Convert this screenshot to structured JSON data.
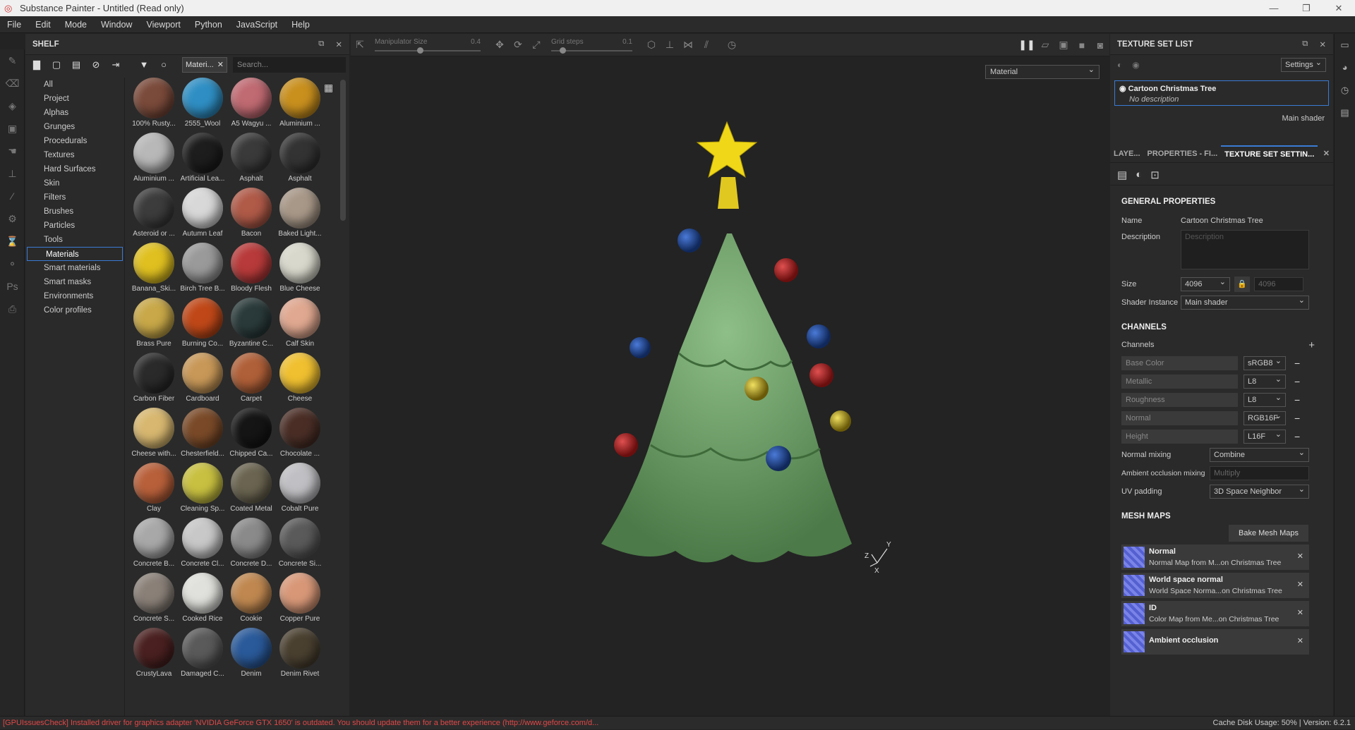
{
  "title": "Substance Painter - Untitled (Read only)",
  "menu": [
    "File",
    "Edit",
    "Mode",
    "Window",
    "Viewport",
    "Python",
    "JavaScript",
    "Help"
  ],
  "shelf": {
    "title": "SHELF",
    "filter_chip": "Materi...",
    "search_placeholder": "Search...",
    "categories": [
      "All",
      "Project",
      "Alphas",
      "Grunges",
      "Procedurals",
      "Textures",
      "Hard Surfaces",
      "Skin",
      "Filters",
      "Brushes",
      "Particles",
      "Tools",
      "Materials",
      "Smart materials",
      "Smart masks",
      "Environments",
      "Color profiles"
    ],
    "selected_category": "Materials",
    "materials": [
      {
        "name": "100% Rusty...",
        "color": "#7a4a3a"
      },
      {
        "name": "2555_Wool",
        "color": "#2f8fc4"
      },
      {
        "name": "A5 Wagyu ...",
        "color": "#c06a72"
      },
      {
        "name": "Aluminium ...",
        "color": "#c9901e"
      },
      {
        "name": "Aluminium ...",
        "color": "#b8b8b8"
      },
      {
        "name": "Artificial Lea...",
        "color": "#1d1d1d"
      },
      {
        "name": "Asphalt",
        "color": "#3a3a3a"
      },
      {
        "name": "Asphalt",
        "color": "#333333"
      },
      {
        "name": "Asteroid or ...",
        "color": "#3c3c3c"
      },
      {
        "name": "Autumn Leaf",
        "color": "#d8d8d8"
      },
      {
        "name": "Bacon",
        "color": "#b05a48"
      },
      {
        "name": "Baked Light...",
        "color": "#a89888"
      },
      {
        "name": "Banana_Ski...",
        "color": "#e0c020"
      },
      {
        "name": "Birch Tree B...",
        "color": "#9a9a9a"
      },
      {
        "name": "Bloody Flesh",
        "color": "#b83a3a"
      },
      {
        "name": "Blue Cheese",
        "color": "#d8d8cc"
      },
      {
        "name": "Brass Pure",
        "color": "#c8a848"
      },
      {
        "name": "Burning Co...",
        "color": "#c04818"
      },
      {
        "name": "Byzantine C...",
        "color": "#2a3a3a"
      },
      {
        "name": "Calf Skin",
        "color": "#e0a890"
      },
      {
        "name": "Carbon Fiber",
        "color": "#2a2a2a"
      },
      {
        "name": "Cardboard",
        "color": "#c89858"
      },
      {
        "name": "Carpet",
        "color": "#b06038"
      },
      {
        "name": "Cheese",
        "color": "#f0c030"
      },
      {
        "name": "Cheese with...",
        "color": "#d8b870"
      },
      {
        "name": "Chesterfield...",
        "color": "#7a4a28"
      },
      {
        "name": "Chipped Ca...",
        "color": "#151515"
      },
      {
        "name": "Chocolate ...",
        "color": "#4a2e26"
      },
      {
        "name": "Clay",
        "color": "#b8603a"
      },
      {
        "name": "Cleaning Sp...",
        "color": "#c8c040"
      },
      {
        "name": "Coated Metal",
        "color": "#6a6450"
      },
      {
        "name": "Cobalt Pure",
        "color": "#c0c0c4"
      },
      {
        "name": "Concrete B...",
        "color": "#a8a8a8"
      },
      {
        "name": "Concrete Cl...",
        "color": "#c8c8c8"
      },
      {
        "name": "Concrete D...",
        "color": "#8a8a8a"
      },
      {
        "name": "Concrete Si...",
        "color": "#5a5a5a"
      },
      {
        "name": "Concrete S...",
        "color": "#8a8078"
      },
      {
        "name": "Cooked Rice",
        "color": "#e0e0dc"
      },
      {
        "name": "Cookie",
        "color": "#c08850"
      },
      {
        "name": "Copper Pure",
        "color": "#d89878"
      },
      {
        "name": "CrustyLava",
        "color": "#4a2020"
      },
      {
        "name": "Damaged C...",
        "color": "#5a5a5a"
      },
      {
        "name": "Denim",
        "color": "#2a5a9a"
      },
      {
        "name": "Denim Rivet",
        "color": "#4a4030"
      }
    ]
  },
  "viewport": {
    "manipulator_label": "Manipulator Size",
    "manipulator_value": "0.4",
    "grid_label": "Grid steps",
    "grid_value": "0.1",
    "material_mode": "Material",
    "manipulator_fraction": 0.4,
    "grid_fraction": 0.1
  },
  "texture_set_list": {
    "title": "TEXTURE SET LIST",
    "settings_label": "Settings",
    "item_name": "Cartoon Christmas Tree",
    "item_shader": "Main shader",
    "item_desc": "No description"
  },
  "tabs": [
    "LAYE...",
    "PROPERTIES - FI...",
    "TEXTURE SET SETTIN..."
  ],
  "props": {
    "general_title": "GENERAL PROPERTIES",
    "name_label": "Name",
    "name_value": "Cartoon Christmas Tree",
    "desc_label": "Description",
    "desc_placeholder": "Description",
    "size_label": "Size",
    "size_value": "4096",
    "size_value2": "4096",
    "shader_label": "Shader Instance",
    "shader_value": "Main shader",
    "channels_title": "CHANNELS",
    "channels_label": "Channels",
    "channels": [
      {
        "name": "Base Color",
        "format": "sRGB8"
      },
      {
        "name": "Metallic",
        "format": "L8"
      },
      {
        "name": "Roughness",
        "format": "L8"
      },
      {
        "name": "Normal",
        "format": "RGB16F"
      },
      {
        "name": "Height",
        "format": "L16F"
      }
    ],
    "normal_mixing_label": "Normal mixing",
    "normal_mixing_value": "Combine",
    "ao_mixing_label": "Ambient occlusion mixing",
    "ao_mixing_value": "Multiply",
    "uv_padding_label": "UV padding",
    "uv_padding_value": "3D Space Neighbor",
    "mesh_title": "MESH MAPS",
    "bake_label": "Bake Mesh Maps",
    "mesh_maps": [
      {
        "name": "Normal",
        "desc": "Normal Map from M...on Christmas Tree"
      },
      {
        "name": "World space normal",
        "desc": "World Space Norma...on Christmas Tree"
      },
      {
        "name": "ID",
        "desc": "Color Map from Me...on Christmas Tree"
      },
      {
        "name": "Ambient occlusion",
        "desc": ""
      }
    ]
  },
  "status": {
    "error": "[GPUIssuesCheck] Installed driver for graphics adapter 'NVIDIA GeForce GTX 1650' is outdated. You should update them for a better experience (http://www.geforce.com/d...",
    "cache": "Cache Disk Usage:   50% | Version: 6.2.1"
  }
}
